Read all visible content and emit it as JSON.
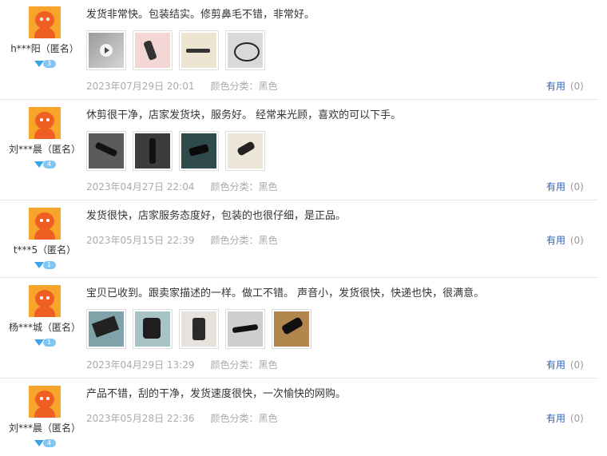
{
  "reviews": [
    {
      "user": "h***阳（匿名）",
      "level": "3",
      "text": "发货非常快。包装结实。修剪鼻毛不错，非常好。",
      "photos": [
        "video-thumb-1",
        "photo-2",
        "photo-3",
        "photo-4"
      ],
      "date": "2023年07月29日 20:01",
      "spec": "颜色分类：黑色",
      "useful_label": "有用",
      "useful_count": "(0)"
    },
    {
      "user": "刘***晨（匿名）",
      "level": "4",
      "text": "休剪很干净，店家发货块，服务好。 经常来光顾，喜欢的可以下手。",
      "photos": [
        "photo-1",
        "photo-2",
        "photo-3",
        "photo-4"
      ],
      "date": "2023年04月27日 22:04",
      "spec": "颜色分类：黑色",
      "useful_label": "有用",
      "useful_count": "(0)"
    },
    {
      "user": "t***5（匿名）",
      "level": "1",
      "text": "发货很快，店家服务态度好，包装的也很仔细，是正品。",
      "photos": [],
      "date": "2023年05月15日 22:39",
      "spec": "颜色分类：黑色",
      "useful_label": "有用",
      "useful_count": "(0)"
    },
    {
      "user": "杨***城（匿名）",
      "level": "1",
      "text": "宝贝已收到。跟卖家描述的一样。做工不错。 声音小，发货很快，快递也快，很满意。",
      "photos": [
        "photo-1",
        "photo-2",
        "photo-3",
        "photo-4",
        "photo-5"
      ],
      "date": "2023年04月29日 13:29",
      "spec": "颜色分类：黑色",
      "useful_label": "有用",
      "useful_count": "(0)"
    },
    {
      "user": "刘***晨（匿名）",
      "level": "4",
      "text": "产品不错，刮的干净，发货速度很快，一次愉快的网购。",
      "photos": [],
      "date": "2023年05月28日 22:36",
      "spec": "颜色分类：黑色",
      "useful_label": "有用",
      "useful_count": "(0)"
    }
  ],
  "colors": {
    "link": "#2f64b4",
    "meta": "#aaaaaa",
    "avatar_bg": "#f7a52a",
    "avatar_fg": "#ef5f24",
    "gem": "#3aa4e9"
  }
}
